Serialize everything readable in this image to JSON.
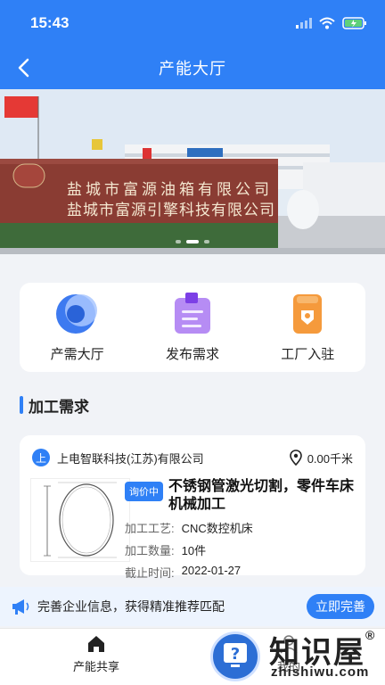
{
  "status_bar": {
    "time": "15:43"
  },
  "header": {
    "title": "产能大厅"
  },
  "banner": {
    "line1": "盐城市富源油箱有限公司",
    "line2": "盐城市富源引擎科技有限公司",
    "slide_count": 3,
    "active_slide": 2
  },
  "quick_actions": [
    {
      "label": "产需大厅",
      "icon": "half-circle-icon"
    },
    {
      "label": "发布需求",
      "icon": "publish-icon"
    },
    {
      "label": "工厂入驻",
      "icon": "factory-icon"
    }
  ],
  "section": {
    "title": "加工需求"
  },
  "demand_card": {
    "avatar_char": "上",
    "company": "上电智联科技(江苏)有限公司",
    "distance": "0.00千米",
    "badge": "询价中",
    "title": "不锈钢管激光切割，零件车床机械加工",
    "process_label": "加工工艺:",
    "process_value": "CNC数控机床",
    "quantity_label": "加工数量:",
    "quantity_value": "10件",
    "deadline_label": "截止时间:",
    "deadline_value": "2022-01-27"
  },
  "promo": {
    "text": "完善企业信息，获得精准推荐匹配",
    "button": "立即完善"
  },
  "tabbar": [
    {
      "label": "产能共享",
      "icon": "home-icon"
    },
    {
      "label": "我的",
      "icon": "user-icon"
    }
  ],
  "watermark": {
    "text": "知识屋",
    "reg": "®",
    "sub": "zhishiwu.com"
  },
  "colors": {
    "primary": "#2f80f6",
    "background": "#f1f3f7"
  }
}
